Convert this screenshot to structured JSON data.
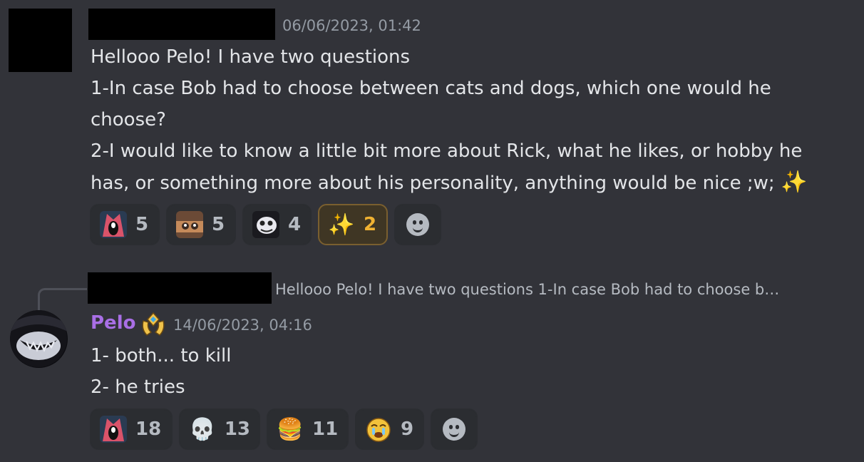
{
  "message1": {
    "timestamp": "06/06/2023, 01:42",
    "lines": [
      "Hellooo Pelo! I have two questions",
      "1-In case Bob had to choose between cats and dogs, which one would he",
      "choose?",
      "2-I would like to know a little bit more about Rick, what he likes, or hobby he",
      "has, or something more about his personality, anything would be nice ;w;"
    ],
    "inline_emoji": "✨",
    "reactions": [
      {
        "icon": "screaming-character-emoji",
        "count": "5"
      },
      {
        "icon": "dog-character-emoji",
        "count": "5"
      },
      {
        "icon": "skull-mask-character-emoji",
        "count": "4"
      },
      {
        "icon": "sparkles-emoji",
        "glyph": "✨",
        "count": "2",
        "selected": true
      }
    ]
  },
  "message2": {
    "reply_preview": "Hellooo Pelo! I have two questions  1-In case Bob had to choose b…",
    "author": "Pelo",
    "author_color": "#a96fe6",
    "badge_icon": "crown-badge-icon",
    "timestamp": "14/06/2023, 04:16",
    "lines": [
      "1- both... to kill",
      "2- he tries"
    ],
    "reactions": [
      {
        "icon": "screaming-character-emoji",
        "count": "18"
      },
      {
        "icon": "skull-emoji",
        "glyph": "💀",
        "count": "13"
      },
      {
        "icon": "hamburger-emoji",
        "glyph": "🍔",
        "count": "11"
      },
      {
        "icon": "crying-face-emoji",
        "count": "9"
      }
    ]
  }
}
